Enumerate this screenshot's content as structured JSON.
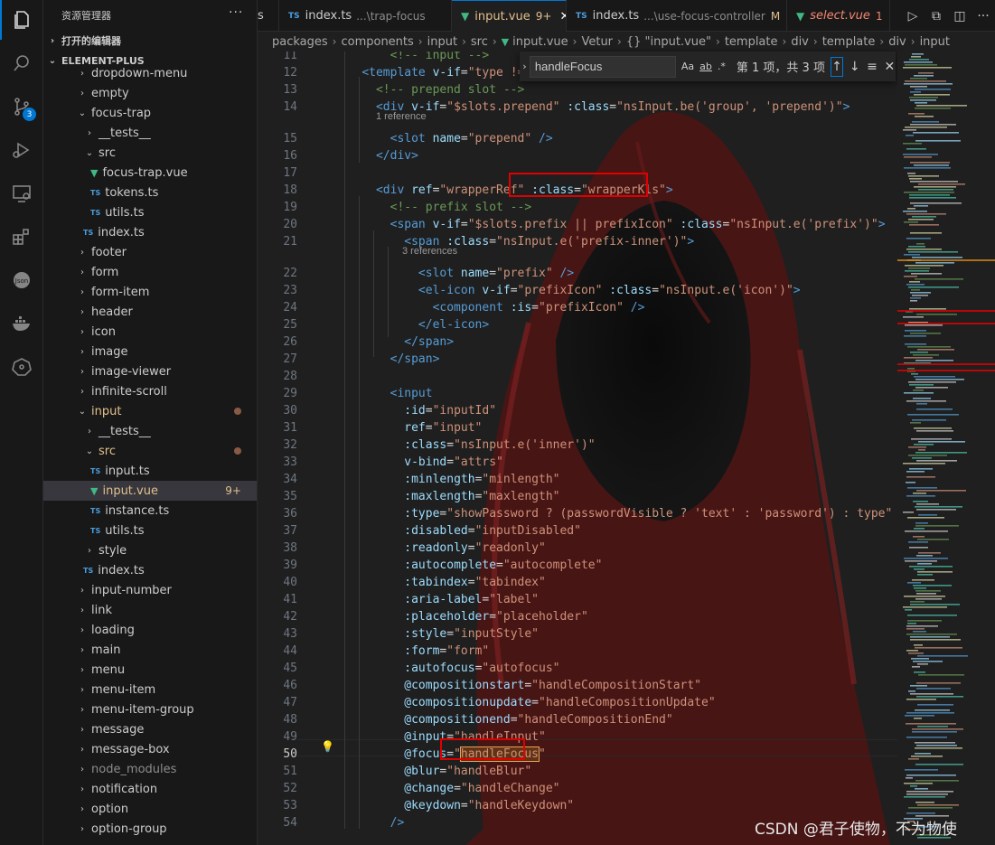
{
  "sidebar": {
    "title": "资源管理器",
    "more": "···",
    "open_editors": "打开的编辑器",
    "workspace": "ELEMENT-PLUS",
    "items": [
      {
        "label": "dropdown-menu",
        "kind": "folder",
        "open": false
      },
      {
        "label": "empty",
        "kind": "folder",
        "open": false
      },
      {
        "label": "focus-trap",
        "kind": "folder",
        "open": true
      },
      {
        "label": "__tests__",
        "kind": "folder",
        "open": false
      },
      {
        "label": "src",
        "kind": "folder",
        "open": true
      },
      {
        "label": "focus-trap.vue",
        "kind": "vue"
      },
      {
        "label": "tokens.ts",
        "kind": "ts"
      },
      {
        "label": "utils.ts",
        "kind": "ts"
      },
      {
        "label": "index.ts",
        "kind": "ts"
      },
      {
        "label": "footer",
        "kind": "folder",
        "open": false
      },
      {
        "label": "form",
        "kind": "folder",
        "open": false
      },
      {
        "label": "form-item",
        "kind": "folder",
        "open": false
      },
      {
        "label": "header",
        "kind": "folder",
        "open": false
      },
      {
        "label": "icon",
        "kind": "folder",
        "open": false
      },
      {
        "label": "image",
        "kind": "folder",
        "open": false
      },
      {
        "label": "image-viewer",
        "kind": "folder",
        "open": false
      },
      {
        "label": "infinite-scroll",
        "kind": "folder",
        "open": false
      },
      {
        "label": "input",
        "kind": "folder",
        "open": true
      },
      {
        "label": "__tests__",
        "kind": "folder",
        "open": false
      },
      {
        "label": "src",
        "kind": "folder",
        "open": true
      },
      {
        "label": "input.ts",
        "kind": "ts"
      },
      {
        "label": "input.vue",
        "kind": "vue",
        "count": "9+"
      },
      {
        "label": "instance.ts",
        "kind": "ts"
      },
      {
        "label": "utils.ts",
        "kind": "ts"
      },
      {
        "label": "style",
        "kind": "folder",
        "open": false
      },
      {
        "label": "index.ts",
        "kind": "ts"
      },
      {
        "label": "input-number",
        "kind": "folder",
        "open": false
      },
      {
        "label": "link",
        "kind": "folder",
        "open": false
      },
      {
        "label": "loading",
        "kind": "folder",
        "open": false
      },
      {
        "label": "main",
        "kind": "folder",
        "open": false
      },
      {
        "label": "menu",
        "kind": "folder",
        "open": false
      },
      {
        "label": "menu-item",
        "kind": "folder",
        "open": false
      },
      {
        "label": "menu-item-group",
        "kind": "folder",
        "open": false
      },
      {
        "label": "message",
        "kind": "folder",
        "open": false
      },
      {
        "label": "message-box",
        "kind": "folder",
        "open": false
      },
      {
        "label": "node_modules",
        "kind": "folder",
        "open": false
      },
      {
        "label": "notification",
        "kind": "folder",
        "open": false
      },
      {
        "label": "option",
        "kind": "folder",
        "open": false
      },
      {
        "label": "option-group",
        "kind": "folder",
        "open": false
      }
    ]
  },
  "tabs": [
    {
      "name": "s",
      "path": "",
      "status": ""
    },
    {
      "name": "index.ts",
      "path": "...\\trap-focus",
      "status": ""
    },
    {
      "name": "input.vue",
      "path": "",
      "status": "9+"
    },
    {
      "name": "index.ts",
      "path": "...\\use-focus-controller",
      "status": "M"
    },
    {
      "name": "select.vue",
      "path": "",
      "status": "1"
    }
  ],
  "breadcrumb": [
    "packages",
    "components",
    "input",
    "src",
    "input.vue",
    "Vetur",
    "{} \"input.vue\"",
    "template",
    "div",
    "template",
    "div",
    "input"
  ],
  "find": {
    "query": "handleFocus",
    "opt_case": "Aa",
    "opt_word": "ab",
    "opt_regex": ".*",
    "result": "第 1 项，共 3 项",
    "prev": "↑",
    "next": "↓",
    "sel": "≡",
    "close": "✕"
  },
  "editor": {
    "current_line": 50,
    "lenses": [
      "1 reference",
      "3 references"
    ],
    "line_numbers": [
      "11",
      "12",
      "13",
      "14",
      "15",
      "16",
      "17",
      "18",
      "19",
      "20",
      "21",
      "22",
      "23",
      "24",
      "25",
      "26",
      "27",
      "28",
      "29",
      "30",
      "31",
      "32",
      "33",
      "34",
      "35",
      "36",
      "37",
      "38",
      "39",
      "40",
      "41",
      "42",
      "43",
      "44",
      "45",
      "46",
      "47",
      "48",
      "49",
      "50",
      "51",
      "52",
      "53",
      "54"
    ]
  },
  "watermark": "CSDN @君子使物，不为物使",
  "colors": {
    "accent": "#0078d4",
    "highlight": "#e00000",
    "vue": "#41b883",
    "ts": "#4a9ee0",
    "modified": "#e2c08d"
  }
}
